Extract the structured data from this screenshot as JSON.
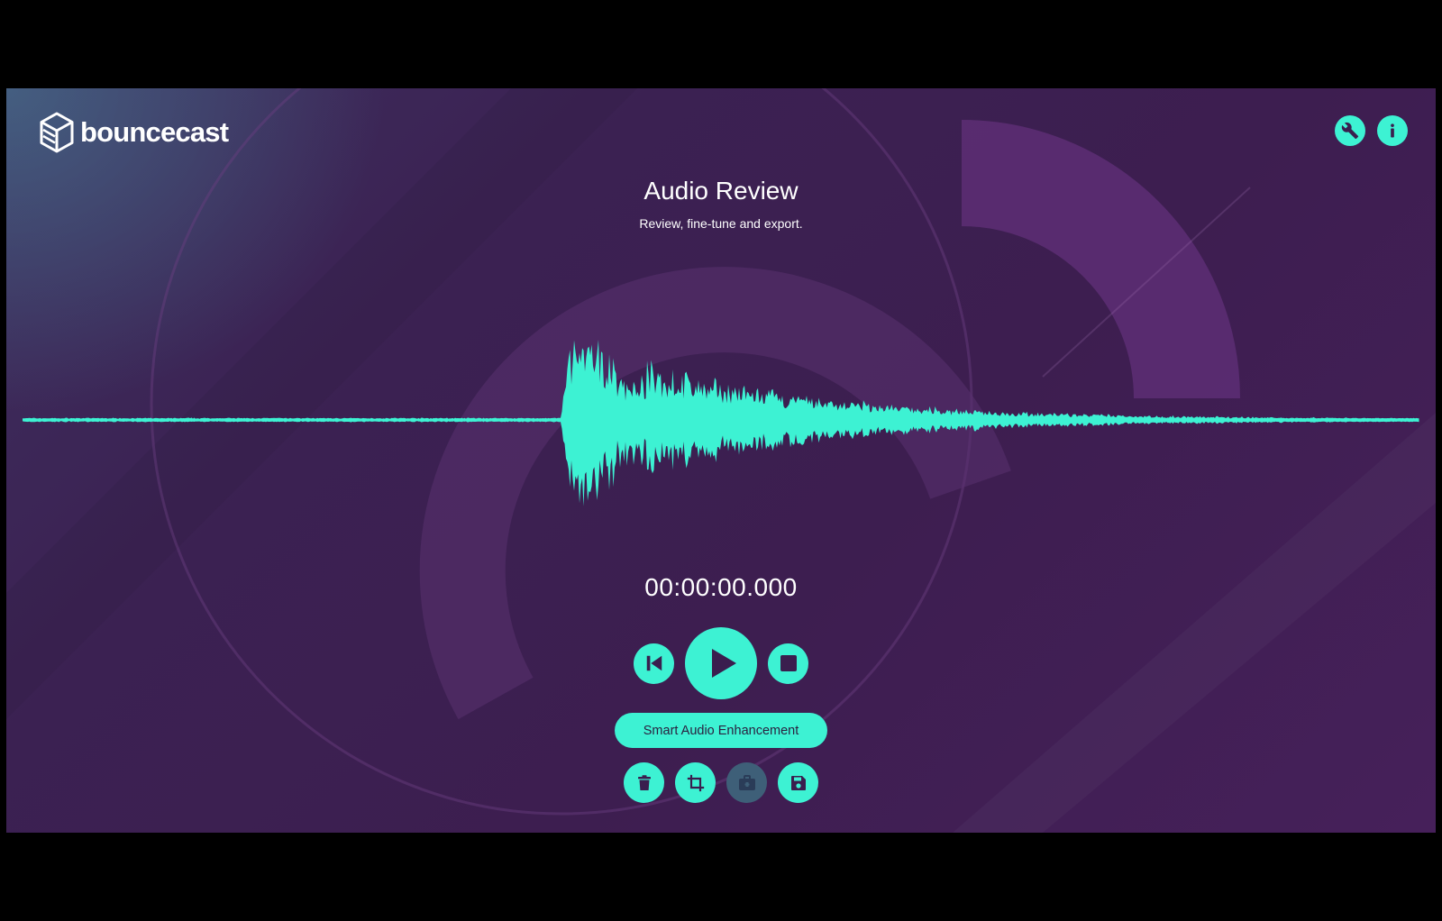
{
  "app": {
    "brand": "bouncecast",
    "accent_color": "#3df2d3",
    "background_color": "#3d1e50"
  },
  "header": {
    "icons": [
      "wrench-icon",
      "info-icon"
    ]
  },
  "page": {
    "title": "Audio Review",
    "subtitle": "Review, fine-tune and export."
  },
  "player": {
    "timecode": "00:00:00.000",
    "controls": [
      "skip-to-start-icon",
      "play-icon",
      "stop-icon"
    ]
  },
  "enhance": {
    "label": "Smart Audio Enhancement"
  },
  "tools": {
    "items": [
      {
        "icon": "trash-icon",
        "enabled": true
      },
      {
        "icon": "crop-icon",
        "enabled": true
      },
      {
        "icon": "toolbox-icon",
        "enabled": false
      },
      {
        "icon": "save-icon",
        "enabled": true
      }
    ]
  }
}
